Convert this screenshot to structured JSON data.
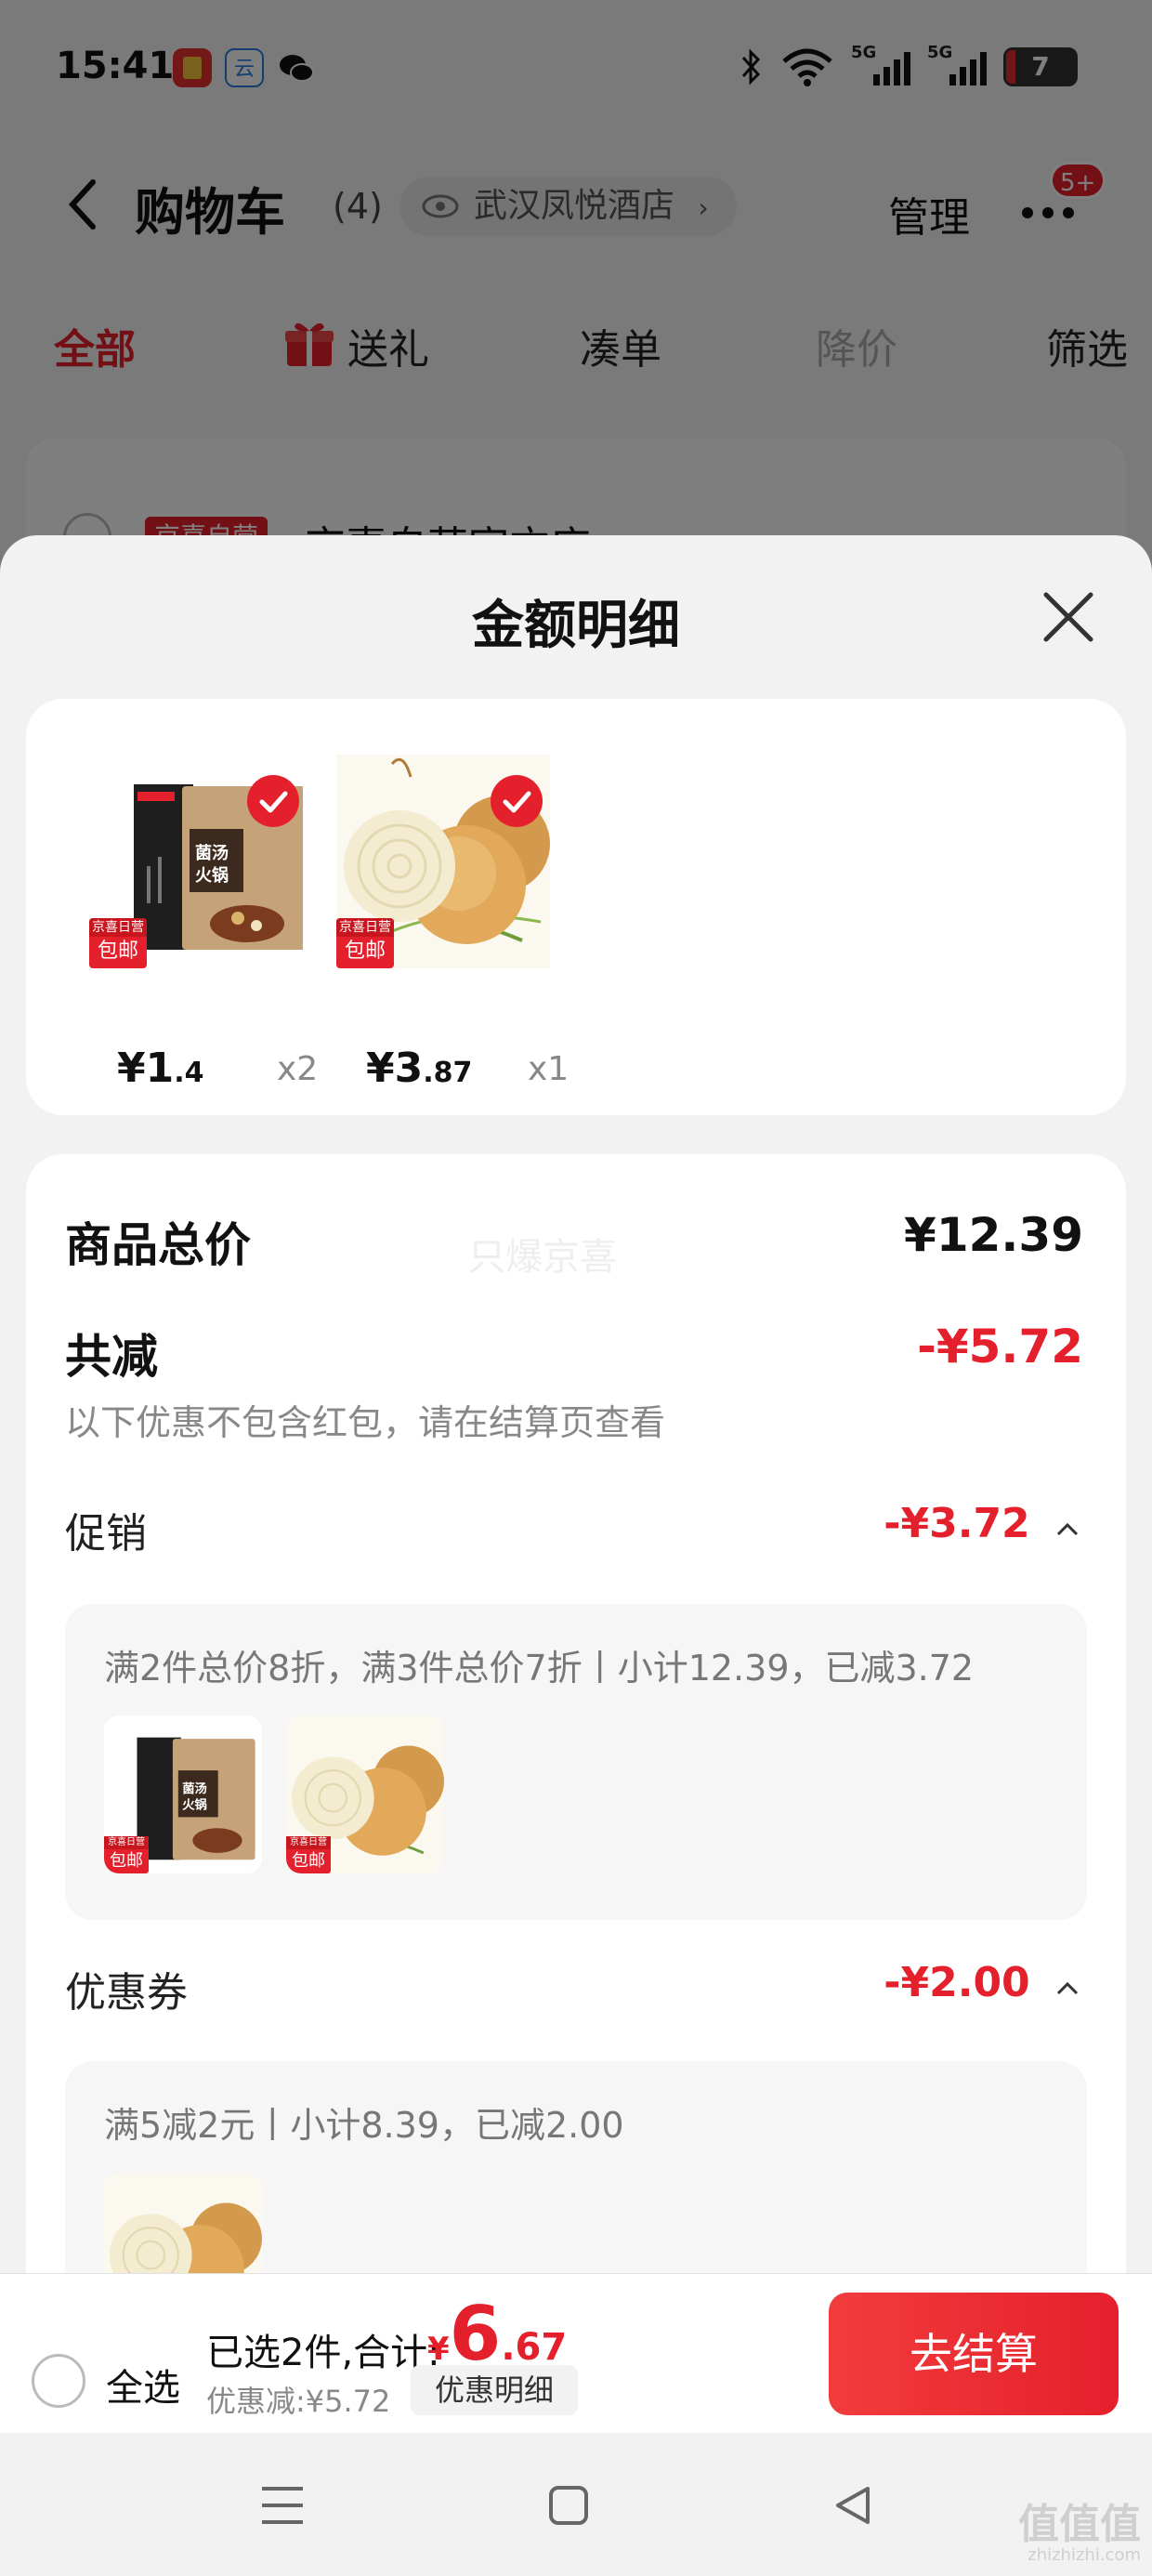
{
  "status_bar": {
    "time": "15:41",
    "battery": "7",
    "network1": "5G",
    "network2": "5G"
  },
  "header": {
    "title": "购物车",
    "count": "(4)",
    "location": "武汉凤悦酒店",
    "manage": "管理",
    "badge": "5+"
  },
  "tabs": [
    {
      "label": "全部",
      "state": "active"
    },
    {
      "label": "送礼",
      "state": "normal"
    },
    {
      "label": "凑单",
      "state": "normal"
    },
    {
      "label": "降价",
      "state": "disabled"
    },
    {
      "label": "筛选",
      "state": "normal"
    }
  ],
  "store": {
    "tag": "京喜自营",
    "name": "京喜自营官方店"
  },
  "sheet": {
    "title": "金额明细",
    "products": [
      {
        "name": "hotpot-seasoning",
        "price_int": "¥1",
        "price_dec": ".4",
        "qty": "x2",
        "tag_top": "京喜日营",
        "tag_bot": "包邮"
      },
      {
        "name": "onion",
        "price_int": "¥3",
        "price_dec": ".87",
        "qty": "x1",
        "tag_top": "京喜日营",
        "tag_bot": "包邮"
      }
    ],
    "goods_total_label": "商品总价",
    "goods_total_value": "¥12.39",
    "watermark": "只爆京喜",
    "discount_label": "共减",
    "discount_value": "-¥5.72",
    "discount_note": "以下优惠不包含红包，请在结算页查看",
    "promo": {
      "label": "促销",
      "value": "-¥3.72",
      "desc": "满2件总价8折，满3件总价7折丨小计12.39，已减3.72"
    },
    "coupon": {
      "label": "优惠券",
      "value": "-¥2.00",
      "desc": "满5减2元丨小计8.39，已减2.00"
    }
  },
  "checkout": {
    "select_all": "全选",
    "selected": "已选2件,合计:",
    "total_cur": "¥",
    "total_int": "6",
    "total_dec": ".67",
    "discount": "优惠减:¥5.72",
    "detail_btn": "优惠明细",
    "submit": "去结算"
  },
  "corner_watermark": {
    "main": "值值值",
    "sub": "zhizhizhi.com"
  },
  "colors": {
    "accent": "#e4202c",
    "text": "#222222",
    "muted": "#888888"
  }
}
